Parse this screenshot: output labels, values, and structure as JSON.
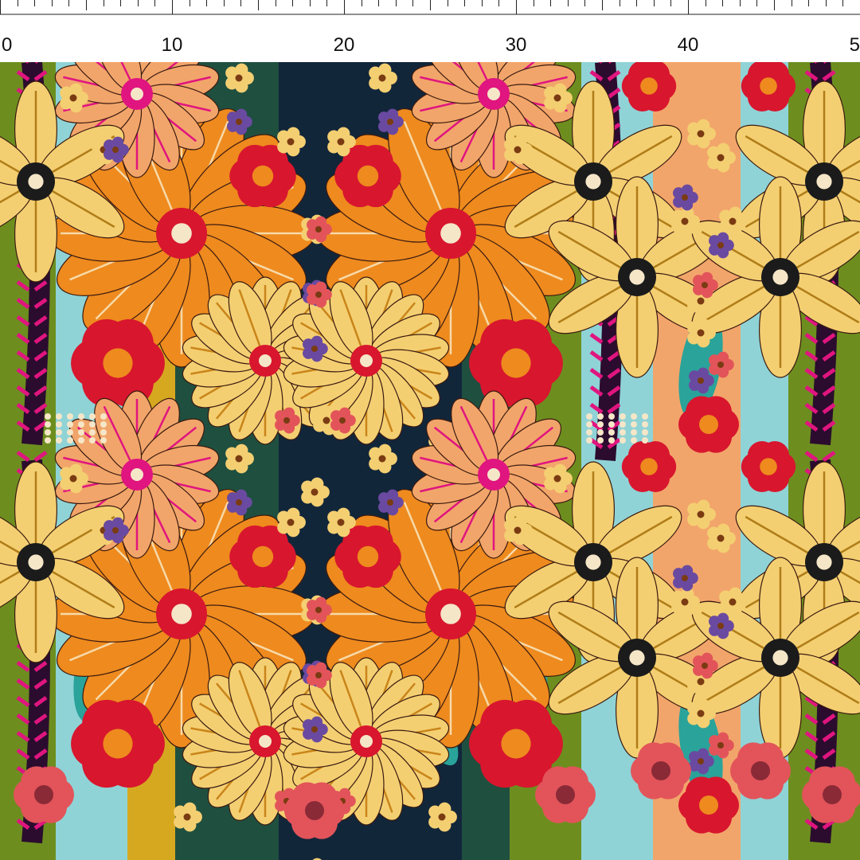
{
  "ruler": {
    "unit_labels": [
      "0",
      "10",
      "20",
      "30",
      "40",
      "5"
    ],
    "minor_ticks_per_label": 10
  },
  "colors": {
    "background_navy": "#12263a",
    "orange": "#ee8a1e",
    "pale_yellow": "#f4cf72",
    "red": "#d8162e",
    "magenta": "#e0157f",
    "teal": "#2aa39a",
    "sky": "#8fd3d6",
    "olive": "#6d8e1f",
    "coral": "#e2545a",
    "purple": "#6a4aa0",
    "mustard": "#d6a820",
    "peach": "#f2a56a",
    "dark_center": "#1b1b1b"
  }
}
